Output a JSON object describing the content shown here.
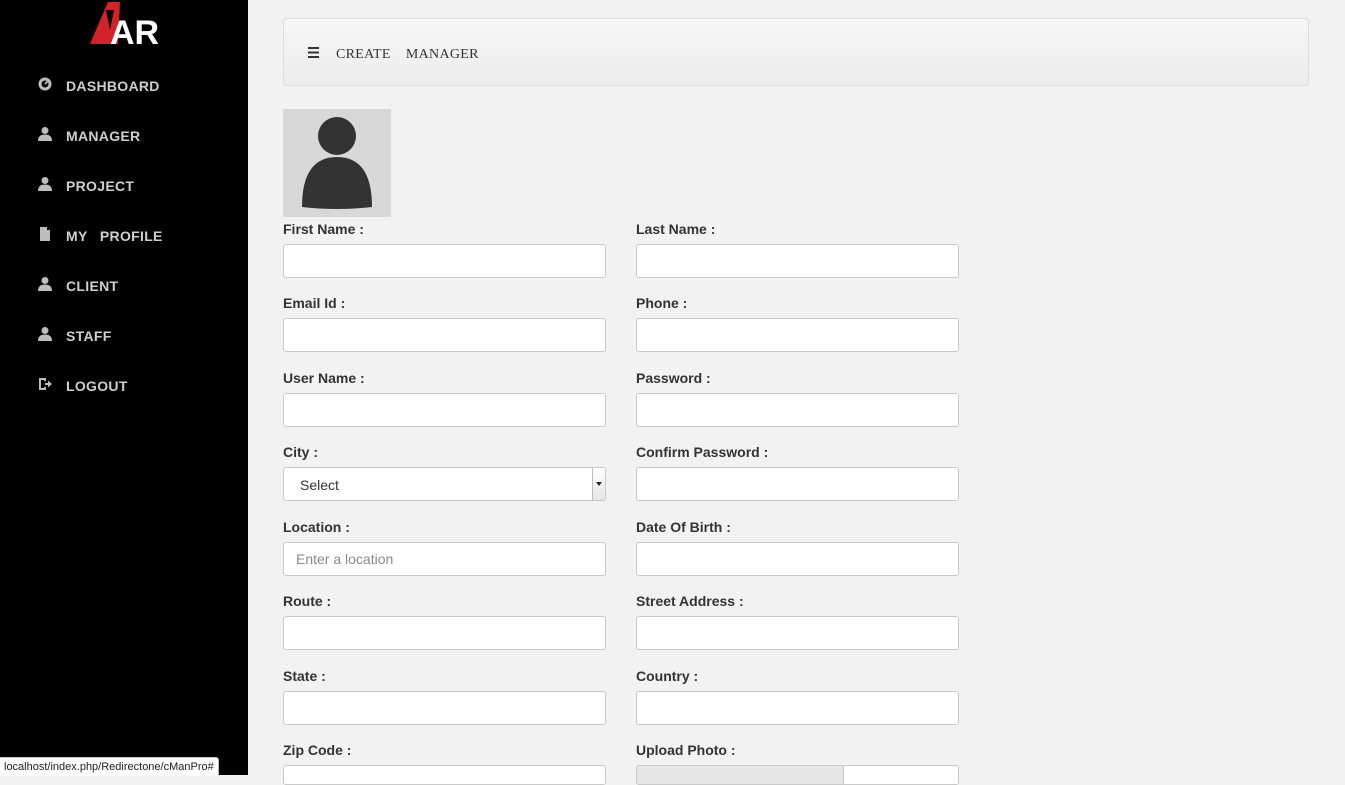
{
  "sidebar": {
    "logo_text": "AR",
    "items": [
      {
        "label": "DASHBOARD",
        "icon": "dashboard-icon"
      },
      {
        "label": "MANAGER",
        "icon": "user-icon"
      },
      {
        "label": "PROJECT",
        "icon": "user-icon"
      },
      {
        "label": "MY   PROFILE",
        "icon": "file-icon"
      },
      {
        "label": "CLIENT",
        "icon": "user-icon"
      },
      {
        "label": "STAFF",
        "icon": "user-icon"
      },
      {
        "label": "LOGOUT",
        "icon": "logout-icon"
      }
    ]
  },
  "header": {
    "title": "CREATE    MANAGER",
    "menu_icon": "hamburger-icon"
  },
  "form": {
    "first_name": {
      "label": "First Name :",
      "value": ""
    },
    "last_name": {
      "label": "Last Name :",
      "value": ""
    },
    "email": {
      "label": "Email Id :",
      "value": ""
    },
    "phone": {
      "label": "Phone :",
      "value": ""
    },
    "username": {
      "label": "User Name :",
      "value": ""
    },
    "password": {
      "label": "Password :",
      "value": ""
    },
    "city": {
      "label": "City :",
      "selected": "Select"
    },
    "confirm_password": {
      "label": "Confirm Password :",
      "value": ""
    },
    "location": {
      "label": "Location :",
      "placeholder": "Enter a location"
    },
    "dob": {
      "label": "Date Of Birth :",
      "value": ""
    },
    "route": {
      "label": "Route :",
      "value": ""
    },
    "street_address": {
      "label": "Street Address :",
      "value": ""
    },
    "state": {
      "label": "State :",
      "value": ""
    },
    "country": {
      "label": "Country :",
      "value": ""
    },
    "zip": {
      "label": "Zip Code :",
      "value": ""
    },
    "upload_photo": {
      "label": "Upload Photo :"
    }
  },
  "status_bar": {
    "url": "localhost/index.php/Redirectone/cManPro#"
  },
  "colors": {
    "sidebar_bg": "#000000",
    "logo_red": "#d3222a",
    "page_bg": "#f2f2f2"
  }
}
